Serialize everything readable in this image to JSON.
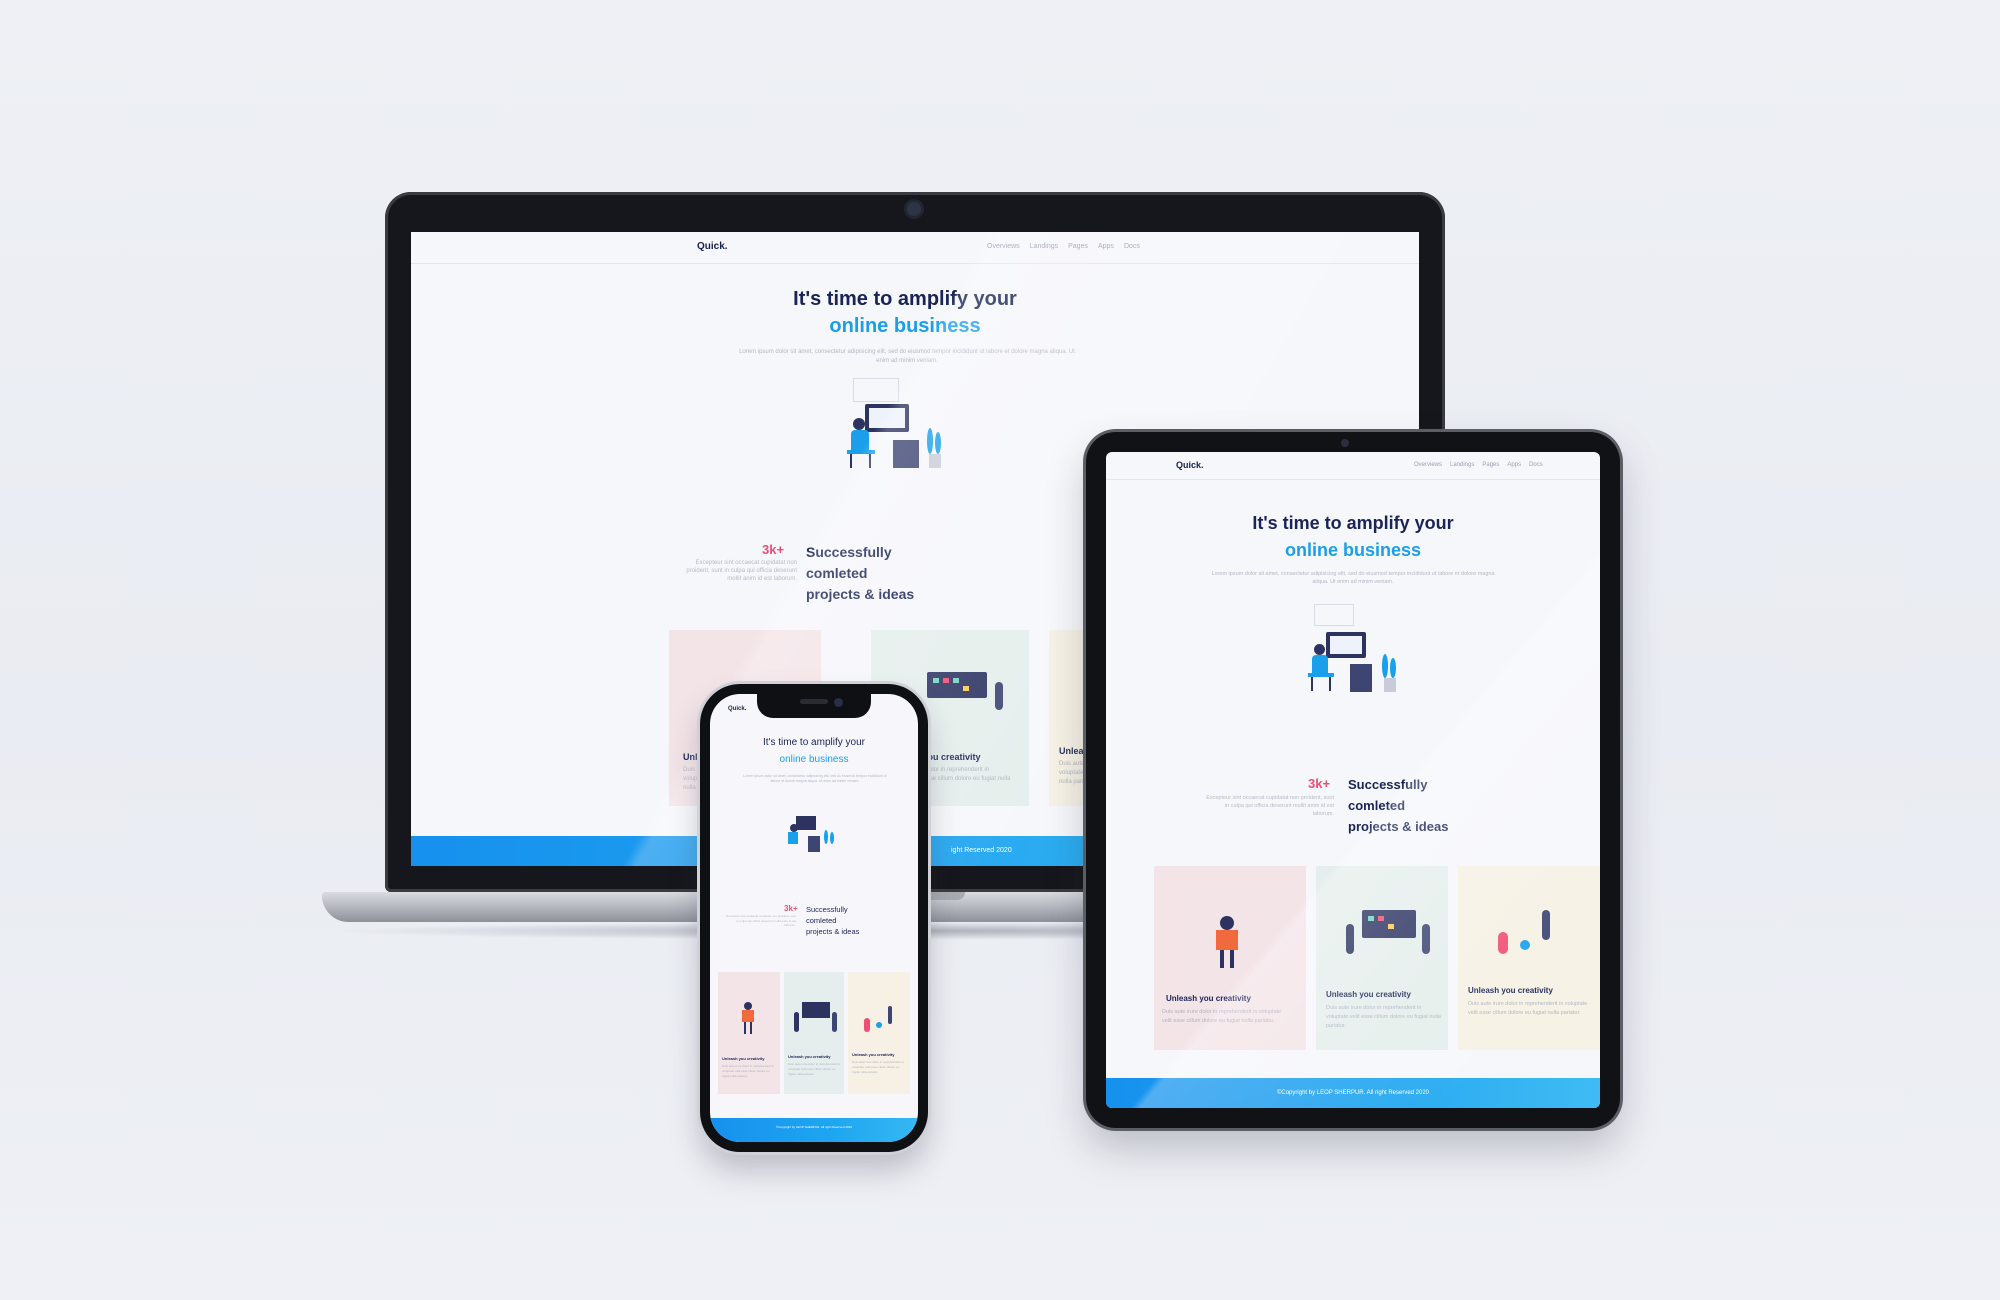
{
  "site": {
    "logo": "Quick.",
    "nav": [
      "Overviews",
      "Landings",
      "Pages",
      "Apps",
      "Docs"
    ],
    "hero": {
      "title_line1": "It's time to amplify your",
      "title_line2": "online business",
      "text": "Lorem ipsum dolor sit amet, consectetur adipisicing elit, sed do eiusmod tempor incididunt ut labore et dolore magna aliqua. Ut enim ad minim veniam."
    },
    "stat": {
      "number": "3k+",
      "text": "Excepteur sint occaecat cupidatat non proident, sunt in culpa qui officia deserunt mollit anim id est laborum.",
      "label_line1": "Successfully",
      "label_line2": "comleted",
      "label_line3": "projects & ideas"
    },
    "cards": [
      {
        "title": "Unleash you creativity",
        "text": "Duis aute irure dolor in reprehenderit in voluptate velit esse cillum dolore eu fugiat nulla pariatur.",
        "color": "#f3e4e8"
      },
      {
        "title": "Unleash you creativity",
        "text": "Duis aute irure dolor in reprehenderit in voluptate velit esse cillum dolore eu fugiat nulla pariatur.",
        "color": "#e5eeec"
      },
      {
        "title": "Unleash you creativity",
        "text": "Duis aute irure dolor in reprehenderit in voluptate velit esse cillum dolore eu fugiat nulla pariatur.",
        "color": "#f6f1e4"
      }
    ],
    "footer": "©Copyright by LEOP SHERPUR. All right Reserved 2020",
    "footer_laptop_visible": "ight Reserved 2020"
  },
  "colors": {
    "navy": "#1a2456",
    "accent_blue": "#1a9fe8",
    "stat_pink": "#ef4e73",
    "footer_blue": "#1691ee"
  }
}
